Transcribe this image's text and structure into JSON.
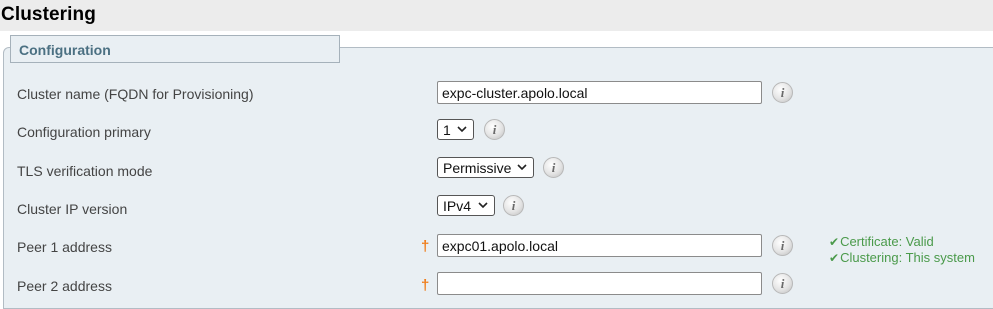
{
  "page": {
    "title": "Clustering"
  },
  "section": {
    "title": "Configuration"
  },
  "form": {
    "cluster_name": {
      "label": "Cluster name (FQDN for Provisioning)",
      "value": "expc-cluster.apolo.local"
    },
    "config_primary": {
      "label": "Configuration primary",
      "value": "1"
    },
    "tls_mode": {
      "label": "TLS verification mode",
      "value": "Permissive"
    },
    "ip_version": {
      "label": "Cluster IP version",
      "value": "IPv4"
    },
    "peer1": {
      "label": "Peer 1 address",
      "required_mark": "†",
      "value": "expc01.apolo.local"
    },
    "peer2": {
      "label": "Peer 2 address",
      "required_mark": "†",
      "value": ""
    }
  },
  "info_icon_glyph": "i",
  "status": {
    "certificate": {
      "check": "✔",
      "text": "Certificate: Valid"
    },
    "clustering": {
      "check": "✔",
      "text": "Clustering: This system"
    }
  },
  "colors": {
    "header_bg": "#ececec",
    "panel_bg": "#e9eff3",
    "section_title": "#4b7082",
    "required": "#f07d1a",
    "status_ok": "#4a9a4a"
  },
  "icons": [
    "info-icon",
    "chevron-down-icon",
    "checkmark-icon"
  ]
}
